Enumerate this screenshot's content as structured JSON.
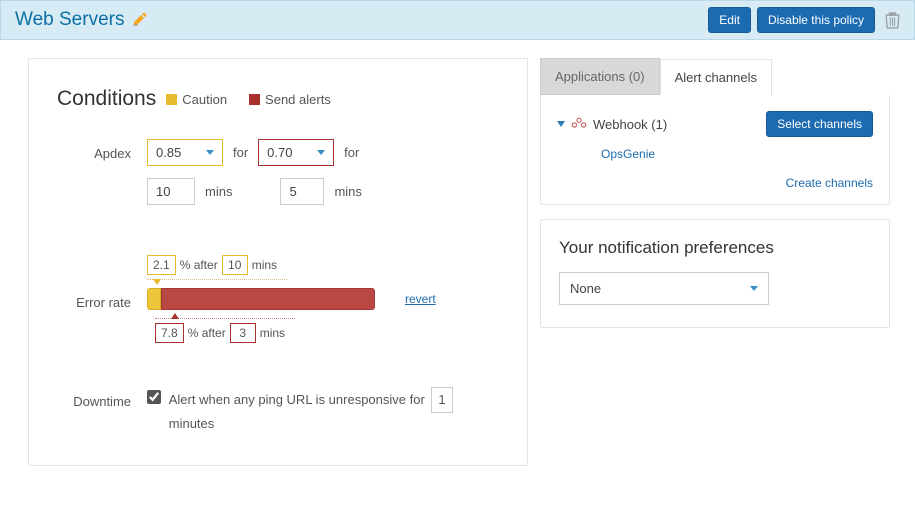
{
  "header": {
    "title": "Web Servers",
    "edit": "Edit",
    "disable": "Disable this policy"
  },
  "conditions": {
    "title": "Conditions",
    "caution_label": "Caution",
    "alert_label": "Send alerts",
    "apdex": {
      "label": "Apdex",
      "caution_value": "0.85",
      "alert_value": "0.70",
      "for": "for",
      "caution_mins": "10",
      "alert_mins": "5",
      "mins_label": "mins"
    },
    "error_rate": {
      "label": "Error rate",
      "caution_pct": "2.1",
      "caution_mins": "10",
      "alert_pct": "7.8",
      "alert_mins": "3",
      "pct_after": "% after",
      "mins_label": "mins",
      "revert": "revert"
    },
    "downtime": {
      "label": "Downtime",
      "checked": true,
      "text_before": "Alert when any ping URL is unresponsive for",
      "minutes_value": "1",
      "text_after": "minutes"
    }
  },
  "tabs": {
    "applications": "Applications (0)",
    "alert_channels": "Alert channels"
  },
  "channels": {
    "webhook_label": "Webhook (1)",
    "select_button": "Select channels",
    "opsgenie": "OpsGenie",
    "create": "Create channels"
  },
  "prefs": {
    "title": "Your notification preferences",
    "value": "None"
  }
}
